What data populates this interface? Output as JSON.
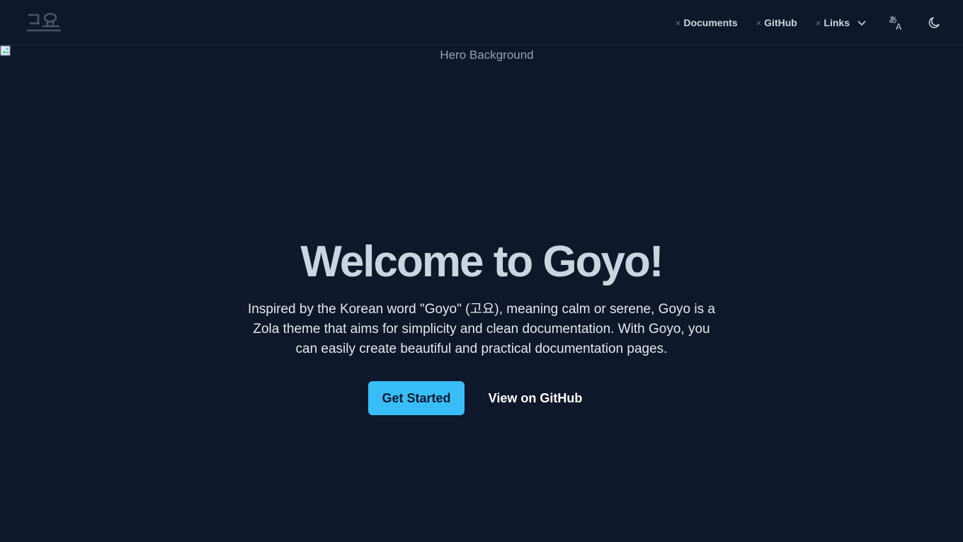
{
  "nav": {
    "links": [
      {
        "label": "Documents",
        "icon": "close-icon"
      },
      {
        "label": "GitHub",
        "icon": "close-icon"
      },
      {
        "label": "Links",
        "icon": "close-icon"
      }
    ],
    "x_glyph": "×",
    "language_icon": "translate-icon",
    "theme_icon": "moon-icon"
  },
  "hero": {
    "background_alt": "Hero Background",
    "title": "Welcome to Goyo!",
    "description": "Inspired by the Korean word \"Goyo\" (고요), meaning calm or serene, Goyo is a Zola theme that aims for simplicity and clean documentation. With Goyo, you can easily create beautiful and practical documentation pages.",
    "primary_button": "Get Started",
    "secondary_button": "View on GitHub"
  },
  "colors": {
    "background": "#0f172a",
    "accent": "#38bdf8",
    "border": "#1e293b"
  }
}
